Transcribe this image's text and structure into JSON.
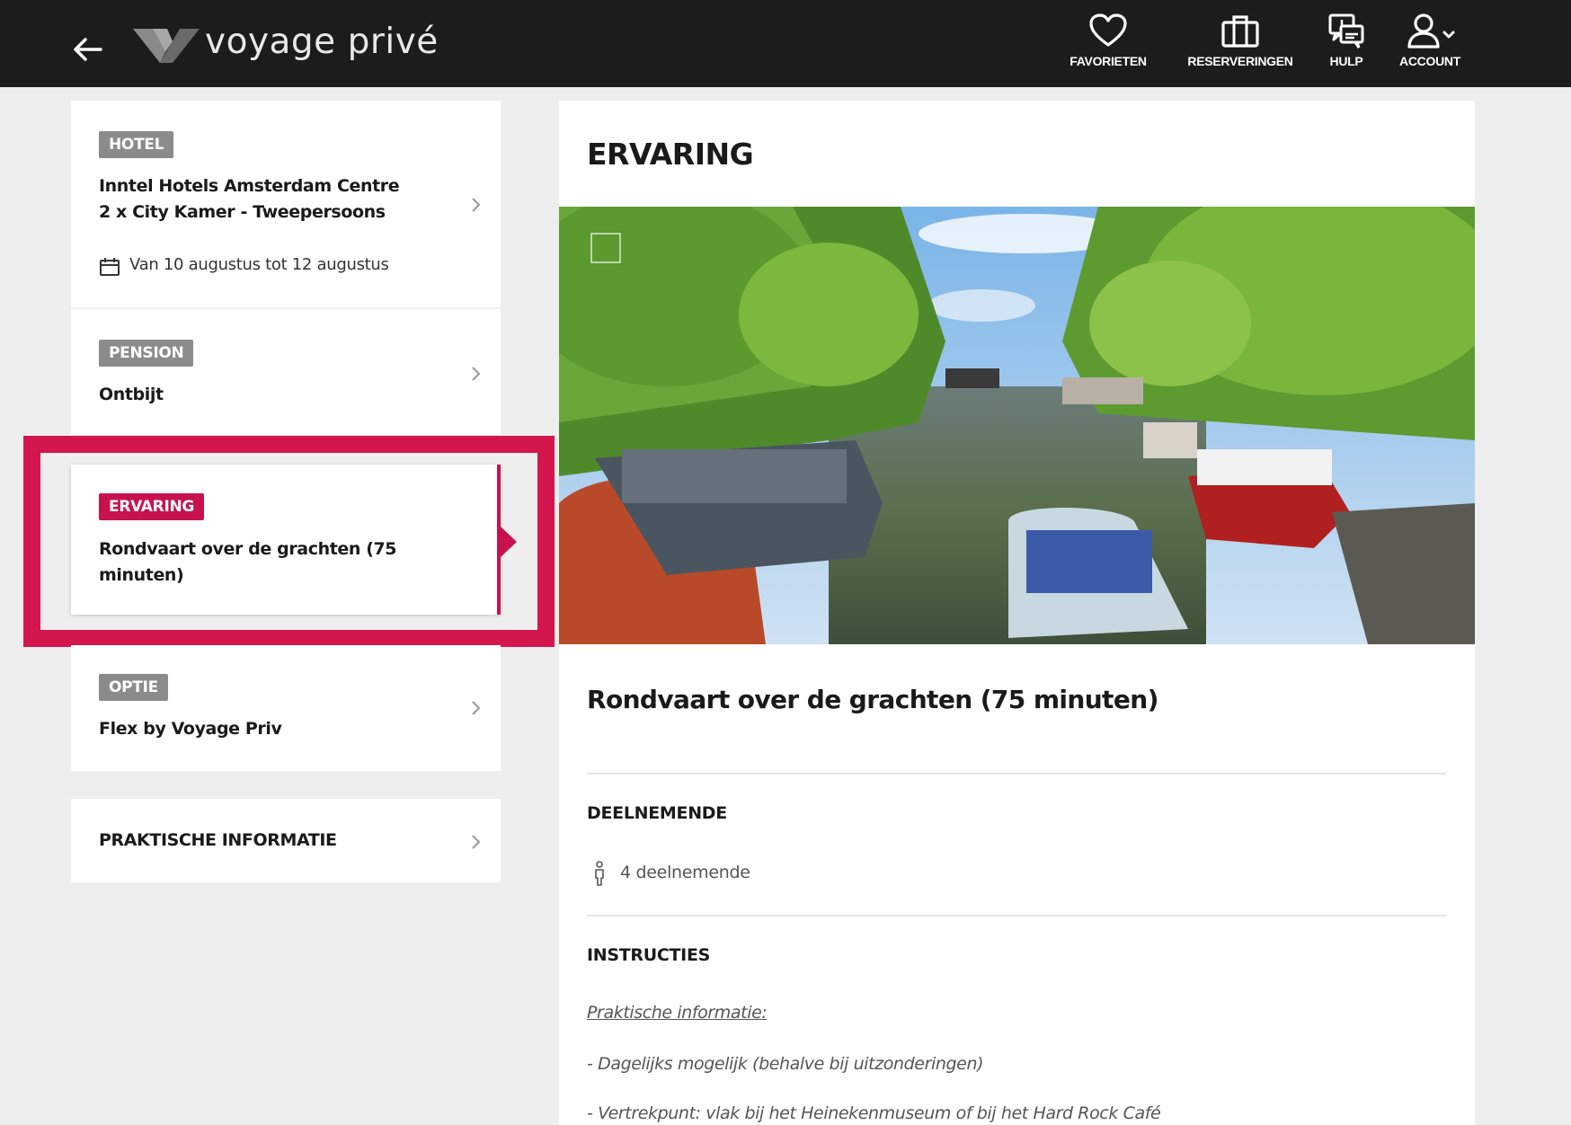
{
  "brand": {
    "name": "voyage privé"
  },
  "nav": [
    {
      "label": "FAVORIETEN",
      "icon": "heart-icon"
    },
    {
      "label": "RESERVERINGEN",
      "icon": "suitcase-icon"
    },
    {
      "label": "HULP",
      "icon": "chat-icon"
    },
    {
      "label": "ACCOUNT",
      "icon": "user-icon"
    }
  ],
  "sidebar": {
    "hotel": {
      "badge": "HOTEL",
      "line1": "Inntel Hotels Amsterdam Centre",
      "line2": "2 x City Kamer - Tweepersoons",
      "dates": "Van 10 augustus tot 12 augustus"
    },
    "pension": {
      "badge": "PENSION",
      "title": "Ontbijt"
    },
    "ervaring": {
      "badge": "ERVARING",
      "line1": "Rondvaart over de grachten (75",
      "line2": "minuten)"
    },
    "optie": {
      "badge": "OPTIE",
      "title": "Flex by Voyage Priv"
    },
    "info": {
      "title": "PRAKTISCHE INFORMATIE"
    }
  },
  "main": {
    "heading": "ERVARING",
    "title": "Rondvaart over de grachten (75 minuten)",
    "participants_label": "DEELNEMENDE",
    "participants_value": "4 deelnemende",
    "instructions_label": "INSTRUCTIES",
    "instr_heading": "Praktische informatie:",
    "instr_line1": "- Dagelijks mogelijk (behalve bij uitzonderingen)",
    "instr_line2": "- Vertrekpunt: vlak bij het Heinekenmuseum of bij het Hard Rock Café"
  },
  "colors": {
    "accent": "#c8124e",
    "highlight": "#d4164f",
    "topbar": "#1c1c1c",
    "badge_grey": "#8b8b8b"
  }
}
